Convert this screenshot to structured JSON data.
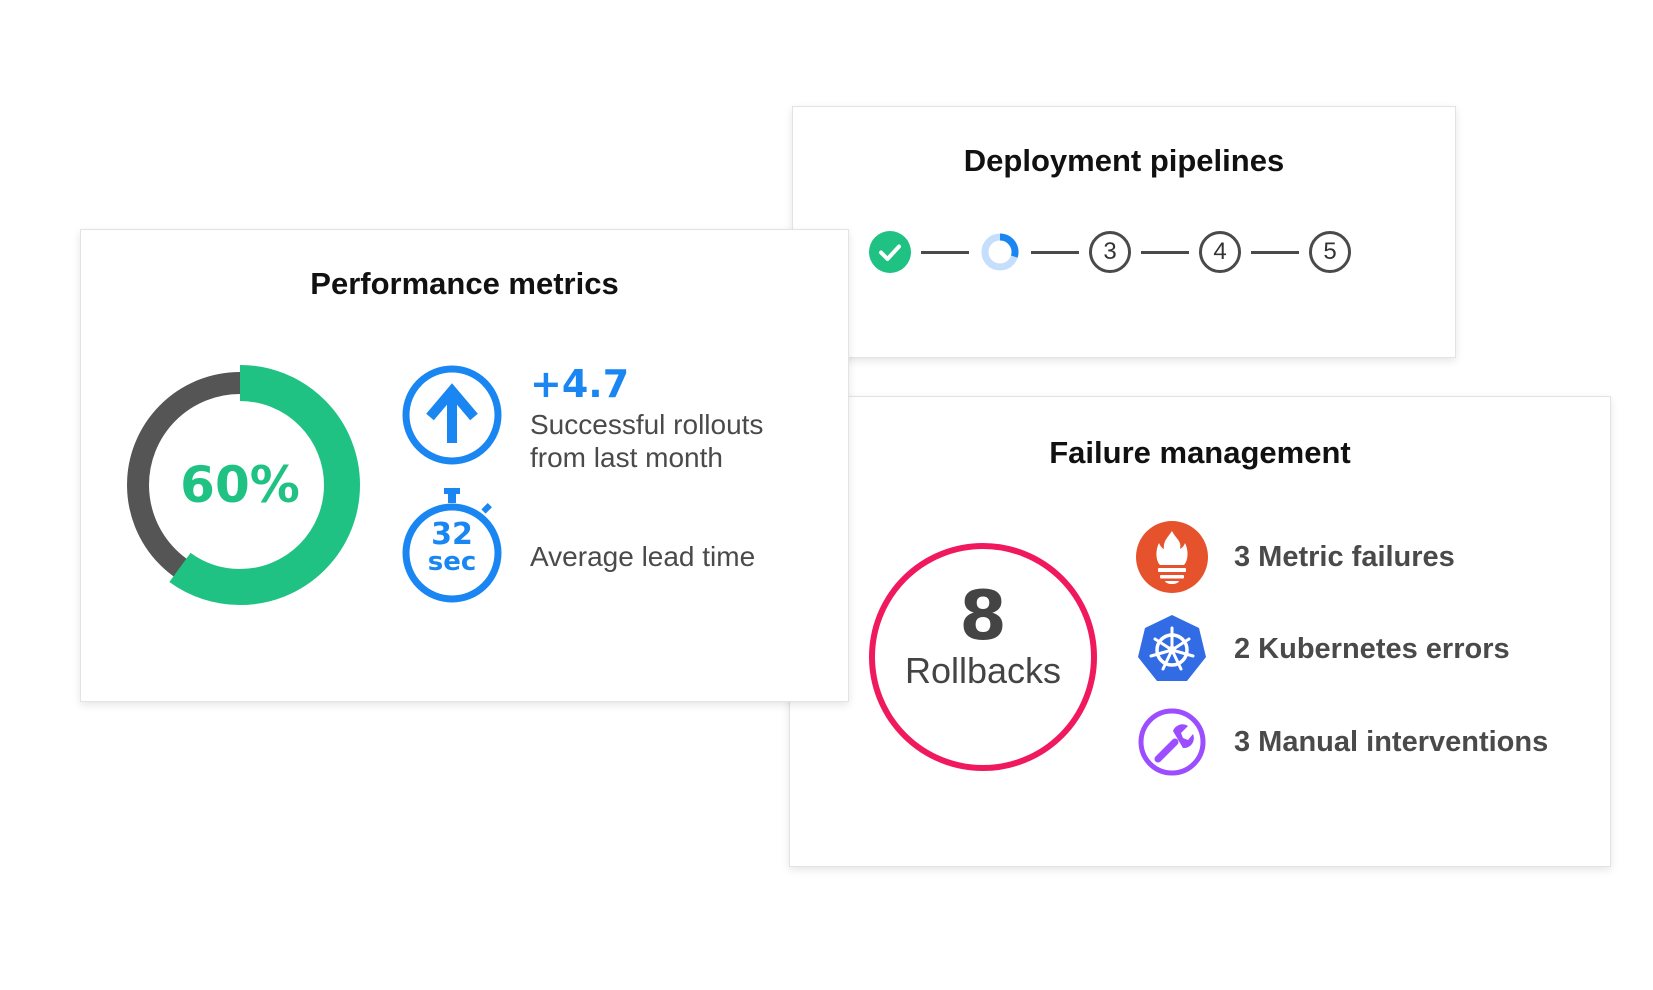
{
  "pipelines": {
    "title": "Deployment pipelines",
    "steps": [
      {
        "state": "complete",
        "icon": "check-icon"
      },
      {
        "state": "in-progress",
        "icon": "progress-spinner-icon"
      },
      {
        "state": "pending",
        "label": "3"
      },
      {
        "state": "pending",
        "label": "4"
      },
      {
        "state": "pending",
        "label": "5"
      }
    ],
    "colors": {
      "complete": "#1fc283",
      "in_progress": "#1a86f2",
      "pending": "#4a4a4a"
    }
  },
  "performance": {
    "title": "Performance metrics",
    "percent_value": 60,
    "percent_label": "60%",
    "rollouts": {
      "value": "+4.7",
      "text_line1": "Successful rollouts",
      "text_line2": "from last month",
      "icon": "arrow-up-icon"
    },
    "lead_time": {
      "number": "32",
      "unit": "sec",
      "label": "Average lead time",
      "icon": "stopwatch-icon"
    },
    "colors": {
      "primary": "#1fc283",
      "remainder": "#555555",
      "accent": "#1a86f2"
    }
  },
  "failure": {
    "title": "Failure management",
    "rollbacks_count": "8",
    "rollbacks_label": "Rollbacks",
    "items": [
      {
        "icon": "prometheus-icon",
        "label": "3 Metric failures",
        "color": "#e6522c"
      },
      {
        "icon": "kubernetes-icon",
        "label": "2 Kubernetes errors",
        "color": "#326ce5"
      },
      {
        "icon": "wrench-icon",
        "label": "3 Manual interventions",
        "color": "#9b4dff"
      }
    ],
    "colors": {
      "rollback_ring": "#f0195d"
    }
  }
}
